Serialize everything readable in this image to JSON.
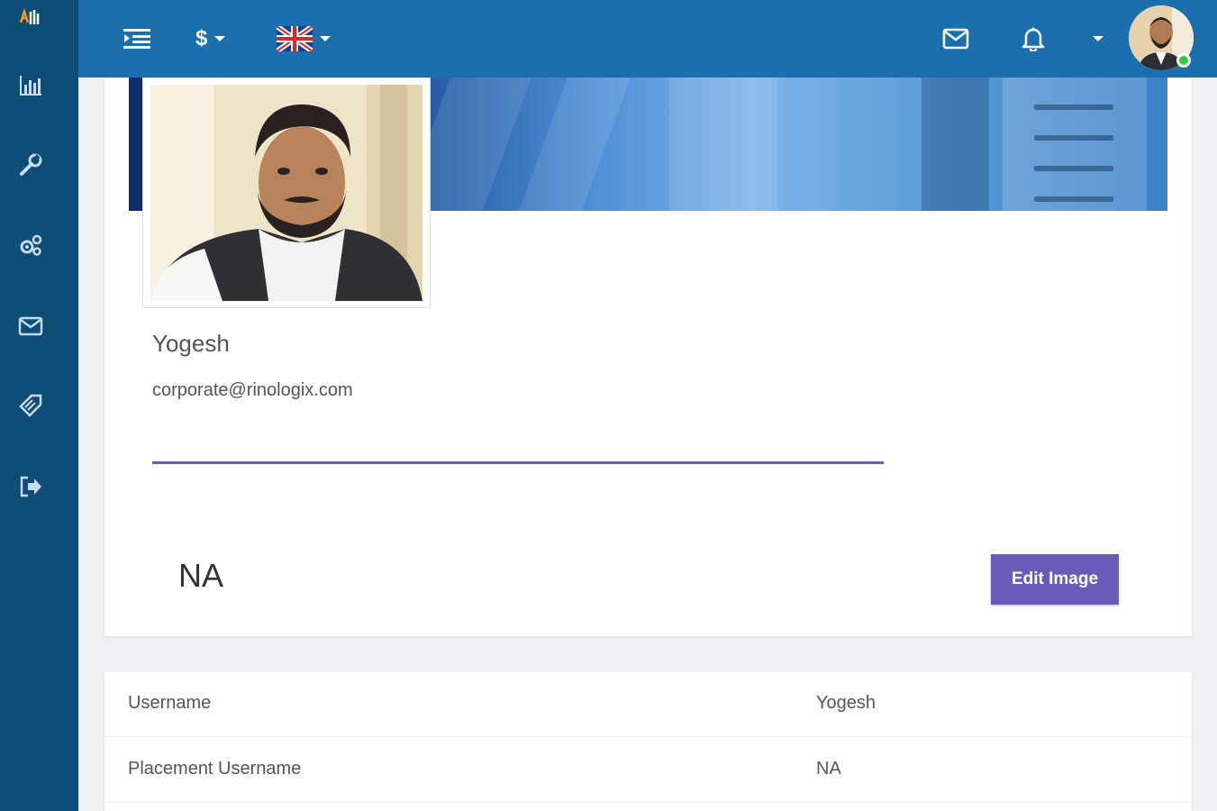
{
  "topbar": {
    "currency_label": "$"
  },
  "profile": {
    "name": "Yogesh",
    "email": "corporate@rinologix.com",
    "status_value": "NA",
    "edit_image_label": "Edit Image"
  },
  "details": {
    "rows": [
      {
        "label": "Username",
        "value": "Yogesh"
      },
      {
        "label": "Placement Username",
        "value": "NA"
      }
    ]
  },
  "colors": {
    "sidebar": "#0e4d78",
    "topbar": "#1b6fae",
    "accent": "#6b5bb8",
    "online": "#2ecc40"
  },
  "icons": {
    "sidebar": [
      "brand-logo-icon",
      "bar-chart-icon",
      "wrench-icon",
      "gears-icon",
      "envelope-icon",
      "tag-icon",
      "logout-icon"
    ],
    "topbar": [
      "menu-toggle-icon",
      "uk-flag-icon",
      "envelope-icon",
      "bell-icon",
      "chevron-down-icon"
    ]
  }
}
